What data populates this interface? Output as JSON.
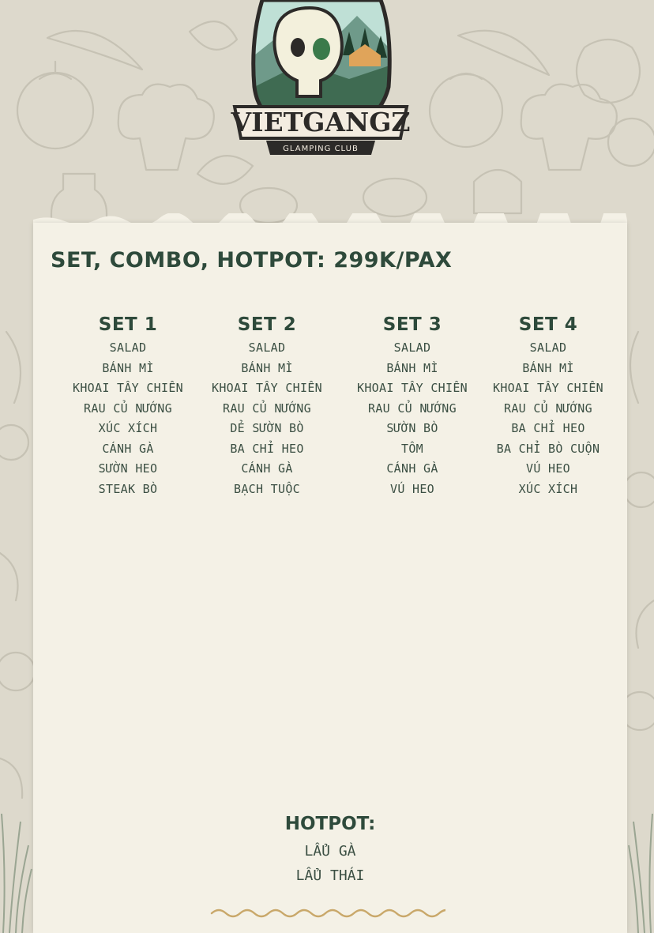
{
  "logo": {
    "brand_name": "VIETGANGZ",
    "brand_subtitle": "GLAMPING CLUB"
  },
  "menu": {
    "heading": "SET, COMBO, HOTPOT: 299K/PAX",
    "sets": [
      {
        "title": "SET 1",
        "items": [
          "SALAD",
          "BÁNH MÌ",
          "KHOAI TÂY CHIÊN",
          "RAU CỦ NƯỚNG",
          "XÚC XÍCH",
          "CÁNH GÀ",
          "SƯỜN HEO",
          "STEAK BÒ"
        ]
      },
      {
        "title": "SET 2",
        "items": [
          "SALAD",
          "BÁNH MÌ",
          "KHOAI TÂY CHIÊN",
          "RAU CỦ NƯỚNG",
          "DẺ SƯỜN BÒ",
          "BA CHỈ HEO",
          "CÁNH GÀ",
          "BẠCH TUỘC"
        ]
      },
      {
        "title": "SET 3",
        "items": [
          "SALAD",
          "BÁNH MÌ",
          "KHOAI TÂY CHIÊN",
          "RAU CỦ NƯỚNG",
          "SƯỜN BÒ",
          "TÔM",
          "CÁNH GÀ",
          "VÚ HEO"
        ]
      },
      {
        "title": "SET 4",
        "items": [
          "SALAD",
          "BÁNH MÌ",
          "KHOAI TÂY CHIÊN",
          "RAU CỦ NƯỚNG",
          "BA CHỈ HEO",
          "BA CHỈ BÒ CUỘN",
          "VÚ HEO",
          "XÚC XÍCH"
        ]
      }
    ],
    "hotpot": {
      "title": "HOTPOT:",
      "items": [
        "LẨU GÀ",
        "LẨU THÁI"
      ]
    }
  },
  "colors": {
    "background": "#ddd9cc",
    "paper": "#f4f1e6",
    "text_dark_green": "#2e4a3b",
    "accent_tan": "#c9a86a"
  }
}
